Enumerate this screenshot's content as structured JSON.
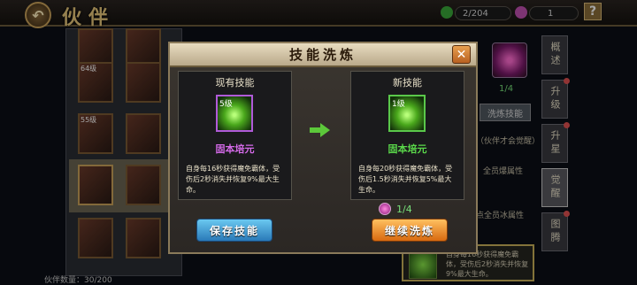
{
  "topbar": {
    "title": "伙伴",
    "back_icon": "back-arrow-icon",
    "resource1_value": "2/204",
    "resource2_value": "1",
    "help_label": "?"
  },
  "left_panel": {
    "hero_levels": [
      "64级",
      "55级",
      "",
      "",
      ""
    ],
    "footer_label": "伙伴数量：",
    "footer_count": "30/200"
  },
  "side_tabs": [
    "概述",
    "升级",
    "升星",
    "觉醒",
    "图腾"
  ],
  "background": {
    "ratio": "1/4",
    "refine_button": "洗炼技能",
    "note_awaken": "（伙伴才会觉醒）",
    "attr_line1": "全员爆属性",
    "attr_line2": "点全员冰属性",
    "desc_box_text": "自身每16秒获得魔免霸体，受伤后2秒消失并恢复9%最大生命。"
  },
  "modal": {
    "title": "技能洗炼",
    "close_label": "✕",
    "current": {
      "heading": "现有技能",
      "level": "5级",
      "name": "固本培元",
      "name_color": "#d46ae8",
      "desc": "自身每16秒获得魔免霸体，受伤后2秒消失并恢复9%最大生命。"
    },
    "new": {
      "heading": "新技能",
      "level": "1级",
      "name": "固本培元",
      "name_color": "#5ad84a",
      "desc": "自身每20秒获得魔免霸体，受伤后1.5秒消失并恢复5%最大生命。"
    },
    "cost": "1/4",
    "save_button": "保存技能",
    "continue_button": "继续洗炼"
  }
}
